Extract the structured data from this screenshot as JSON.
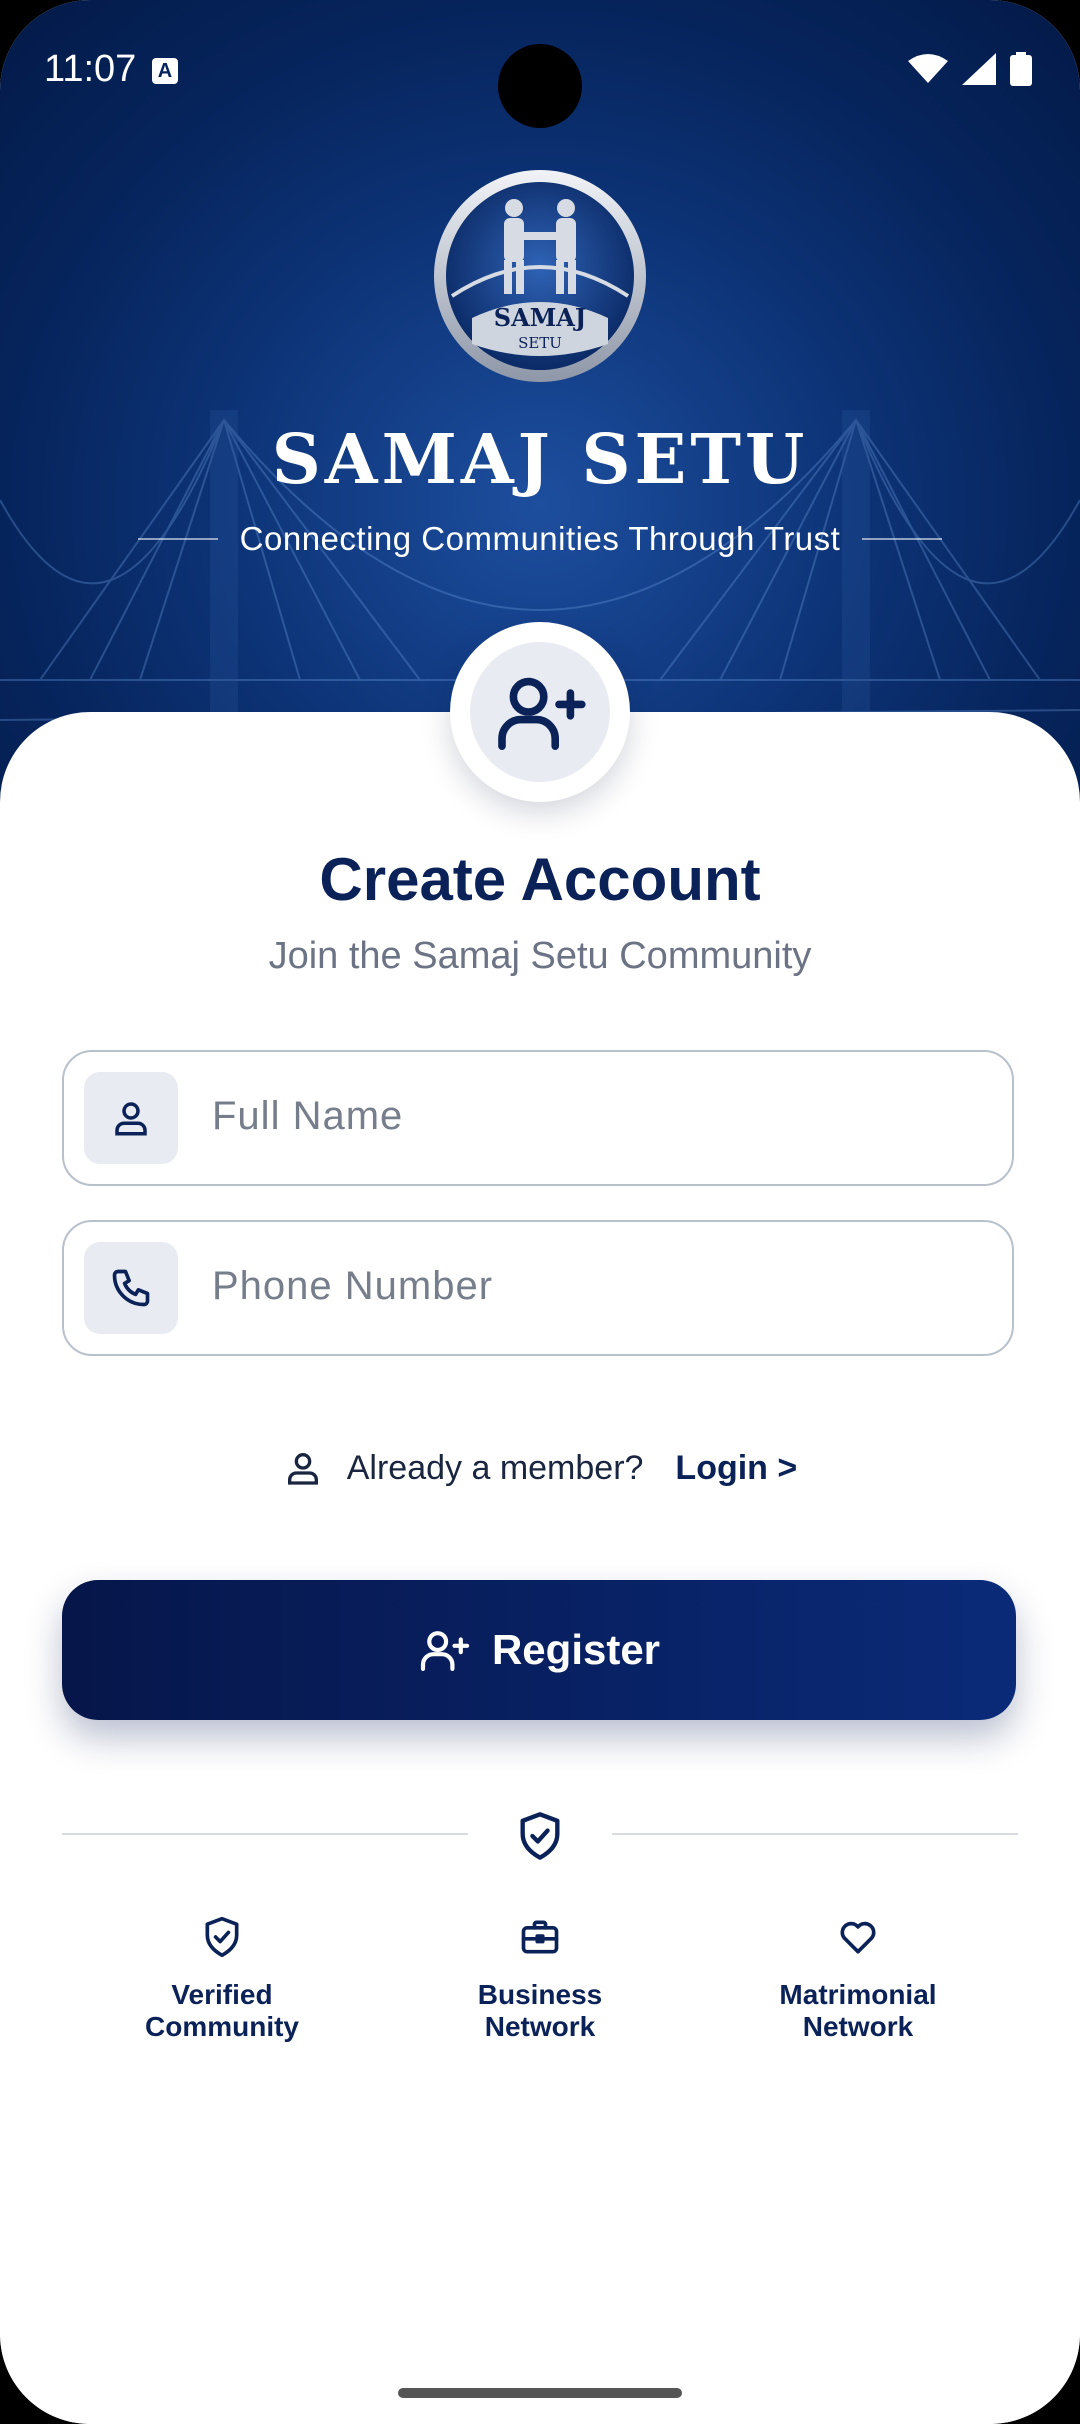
{
  "status_bar": {
    "time": "11:07"
  },
  "brand": {
    "name": "SAMAJ SETU",
    "tagline": "Connecting Communities Through Trust",
    "logo_text_top": "SAMAJ",
    "logo_text_bottom": "SETU"
  },
  "form": {
    "title": "Create Account",
    "subtitle": "Join the Samaj Setu Community",
    "full_name_placeholder": "Full Name",
    "phone_placeholder": "Phone Number",
    "member_prompt": "Already a member?",
    "login_link": "Login >",
    "register_label": "Register"
  },
  "features": [
    {
      "icon": "shield-check-icon",
      "line1": "Verified",
      "line2": "Community"
    },
    {
      "icon": "briefcase-icon",
      "line1": "Business",
      "line2": "Network"
    },
    {
      "icon": "heart-icon",
      "line1": "Matrimonial",
      "line2": "Network"
    }
  ],
  "colors": {
    "primary": "#0b2258",
    "hero": "#0d3478",
    "placeholder": "#767d8b"
  }
}
